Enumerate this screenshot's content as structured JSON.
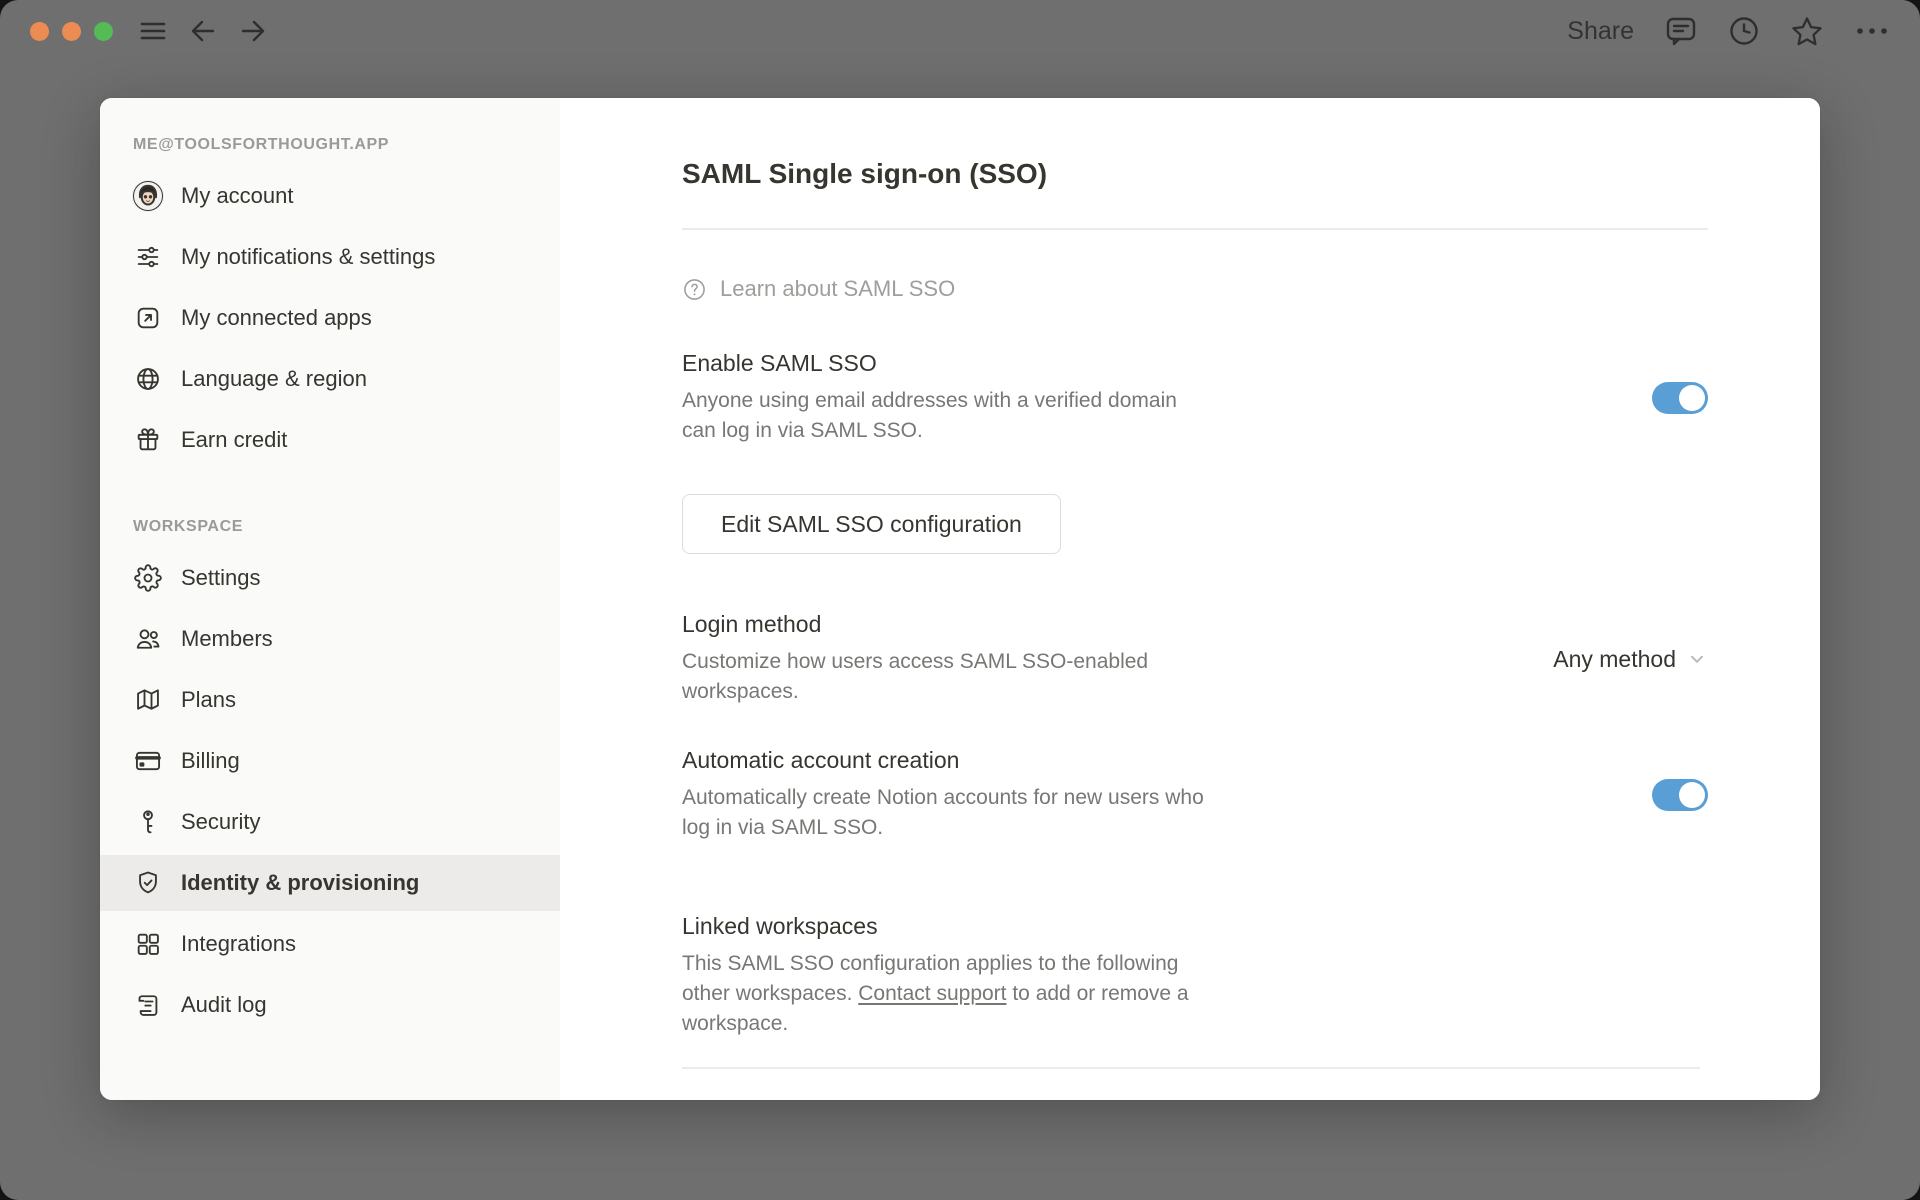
{
  "titlebar": {
    "share_label": "Share"
  },
  "sidebar": {
    "account_section_label": "ME@TOOLSFORTHOUGHT.APP",
    "account_items": [
      {
        "label": "My account",
        "icon": "avatar"
      },
      {
        "label": "My notifications & settings",
        "icon": "sliders-icon"
      },
      {
        "label": "My connected apps",
        "icon": "arrow-up-right-square-icon"
      },
      {
        "label": "Language & region",
        "icon": "globe-icon"
      },
      {
        "label": "Earn credit",
        "icon": "gift-icon"
      }
    ],
    "workspace_section_label": "WORKSPACE",
    "workspace_items": [
      {
        "label": "Settings",
        "icon": "gear-icon"
      },
      {
        "label": "Members",
        "icon": "members-icon"
      },
      {
        "label": "Plans",
        "icon": "map-icon"
      },
      {
        "label": "Billing",
        "icon": "credit-card-icon"
      },
      {
        "label": "Security",
        "icon": "key-icon"
      },
      {
        "label": "Identity & provisioning",
        "icon": "shield-check-icon",
        "selected": true
      },
      {
        "label": "Integrations",
        "icon": "grid-icon"
      },
      {
        "label": "Audit log",
        "icon": "scroll-icon"
      }
    ]
  },
  "main": {
    "title": "SAML Single sign-on (SSO)",
    "learn_link_label": "Learn about SAML SSO",
    "enable": {
      "heading": "Enable SAML SSO",
      "description": "Anyone using email addresses with a verified domain can log in via SAML SSO.",
      "toggle_on": true
    },
    "edit_button_label": "Edit SAML SSO configuration",
    "login_method": {
      "heading": "Login method",
      "description": "Customize how users access SAML SSO-enabled workspaces.",
      "selected_value": "Any method"
    },
    "auto_account": {
      "heading": "Automatic account creation",
      "description": "Automatically create Notion accounts for new users who log in via SAML SSO.",
      "toggle_on": true
    },
    "linked_workspaces": {
      "heading": "Linked workspaces",
      "description_before": "This SAML SSO configuration applies to the following other workspaces. ",
      "link_label": "Contact support",
      "description_after": " to add or remove a workspace."
    }
  },
  "colors": {
    "toggle_blue": "#5A9ED6",
    "traffic_close": "#EC8C52",
    "traffic_min": "#EC8C52",
    "traffic_zoom": "#55BB55"
  }
}
